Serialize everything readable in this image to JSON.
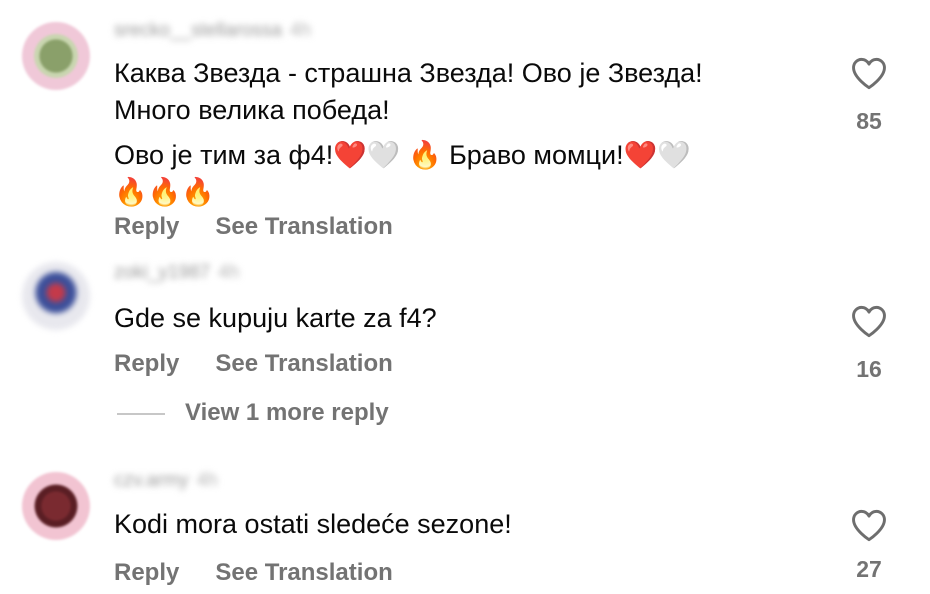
{
  "comments": [
    {
      "username": "srecko__stellarossa",
      "time": "4h",
      "lines": [
        "Каква Звезда - страшна Звезда! Ово је Звезда!",
        "Много велика победа!",
        "Ово је тим за ф4!❤️🤍 🔥 Браво момци!❤️🤍",
        "🔥🔥🔥"
      ],
      "reply_label": "Reply",
      "translate_label": "See Translation",
      "likes": "85"
    },
    {
      "username": "zoki_y1987",
      "time": "4h",
      "lines": [
        "Gde se kupuju karte za f4?"
      ],
      "reply_label": "Reply",
      "translate_label": "See Translation",
      "likes": "16"
    },
    {
      "username": "czv.army",
      "time": "4h",
      "lines": [
        "Kodi mora ostati sledeće sezone!"
      ],
      "reply_label": "Reply",
      "translate_label": "See Translation",
      "likes": "27"
    }
  ],
  "view_more": "View 1 more reply",
  "icons": {
    "like": "heart-outline-icon"
  },
  "colors": {
    "secondary_text": "#737373",
    "primary_text": "#0a0a0a"
  }
}
